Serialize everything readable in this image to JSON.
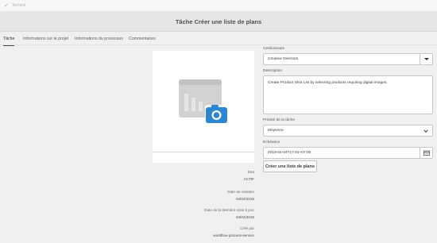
{
  "topbar": {
    "done_label": "Terminé"
  },
  "title": "Tâche Créer une liste de plans",
  "tabs": [
    {
      "label": "Tâche",
      "active": true
    },
    {
      "label": "Informations sur le projet",
      "active": false
    },
    {
      "label": "Informations du processus",
      "active": false
    },
    {
      "label": "Commentaires",
      "active": false
    }
  ],
  "thumbnail": {
    "icon": "image-camera-placeholder-icon"
  },
  "meta": {
    "status_label": "Etat",
    "status_value": "ACTIF",
    "created_label": "Date de création",
    "created_value": "04/04/2018",
    "modified_label": "Date de la dernière mise à jour",
    "modified_value": "04/04/2018",
    "createdby_label": "Créé par",
    "createdby_value": "workflow-process-service"
  },
  "form": {
    "assignee_label": "Gestionnaire",
    "assignee_value": "Creative Directors",
    "description_label": "Description",
    "description_value": "Create Product Shot List by selecting products requiring digital images.",
    "priority_label": "Priorité de la tâche",
    "priority_value": "Moyenne",
    "due_label": "Échéance",
    "due_value": "2018-04-04T17:01+07:00",
    "action_label": "Créer une liste de plans"
  },
  "colors": {
    "accent": "#2b87d3",
    "placeholder_gray": "#cfcfcf"
  }
}
